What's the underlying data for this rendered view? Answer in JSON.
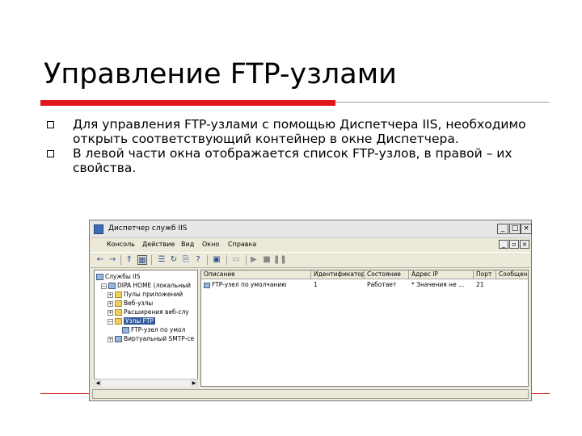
{
  "slide": {
    "title": "Управление FTP-узлами",
    "bullets": [
      "Для управления FTP-узлами с помощью Диспетчера IIS, необходимо открыть соответствующий контейнер в окне Диспетчера.",
      "В левой части окна отображается список FTP-узлов, в правой – их свойства."
    ],
    "accent_color": "#e0151d"
  },
  "window": {
    "title": "Диспетчер служб IIS",
    "controls": {
      "minimize": "_",
      "maximize": "□",
      "close": "×"
    },
    "menu": [
      "Консоль",
      "Действие",
      "Вид",
      "Окно",
      "Справка"
    ],
    "mdi_controls": {
      "minimize": "_",
      "restore": "▫",
      "close": "×"
    },
    "toolbar_icons": [
      "back-icon",
      "forward-icon",
      "up-icon",
      "show-tree-icon",
      "properties-icon",
      "refresh-icon",
      "export-icon",
      "help-icon",
      "computer-icon",
      "play-icon",
      "stop-icon",
      "pause-icon"
    ],
    "tree": [
      {
        "label": "Службы IIS",
        "level": 0
      },
      {
        "label": "DIPA HOME (локальный",
        "level": 1
      },
      {
        "label": "Пулы приложений",
        "level": 2
      },
      {
        "label": "Веб-узлы",
        "level": 2
      },
      {
        "label": "Расширения веб-слу",
        "level": 2
      },
      {
        "label": "Узлы FTP",
        "level": 2,
        "selected": true
      },
      {
        "label": "FTP-узел по умол",
        "level": 3
      },
      {
        "label": "Виртуальный SMTP-се",
        "level": 2
      }
    ],
    "list": {
      "columns": [
        "Описание",
        "Идентификатор",
        "Состояние",
        "Адрес IP",
        "Порт",
        "Сообщение"
      ],
      "rows": [
        [
          "FTP-узел по умолчанию",
          "1",
          "Работает",
          "* Значения не ...",
          "21",
          ""
        ]
      ]
    }
  }
}
